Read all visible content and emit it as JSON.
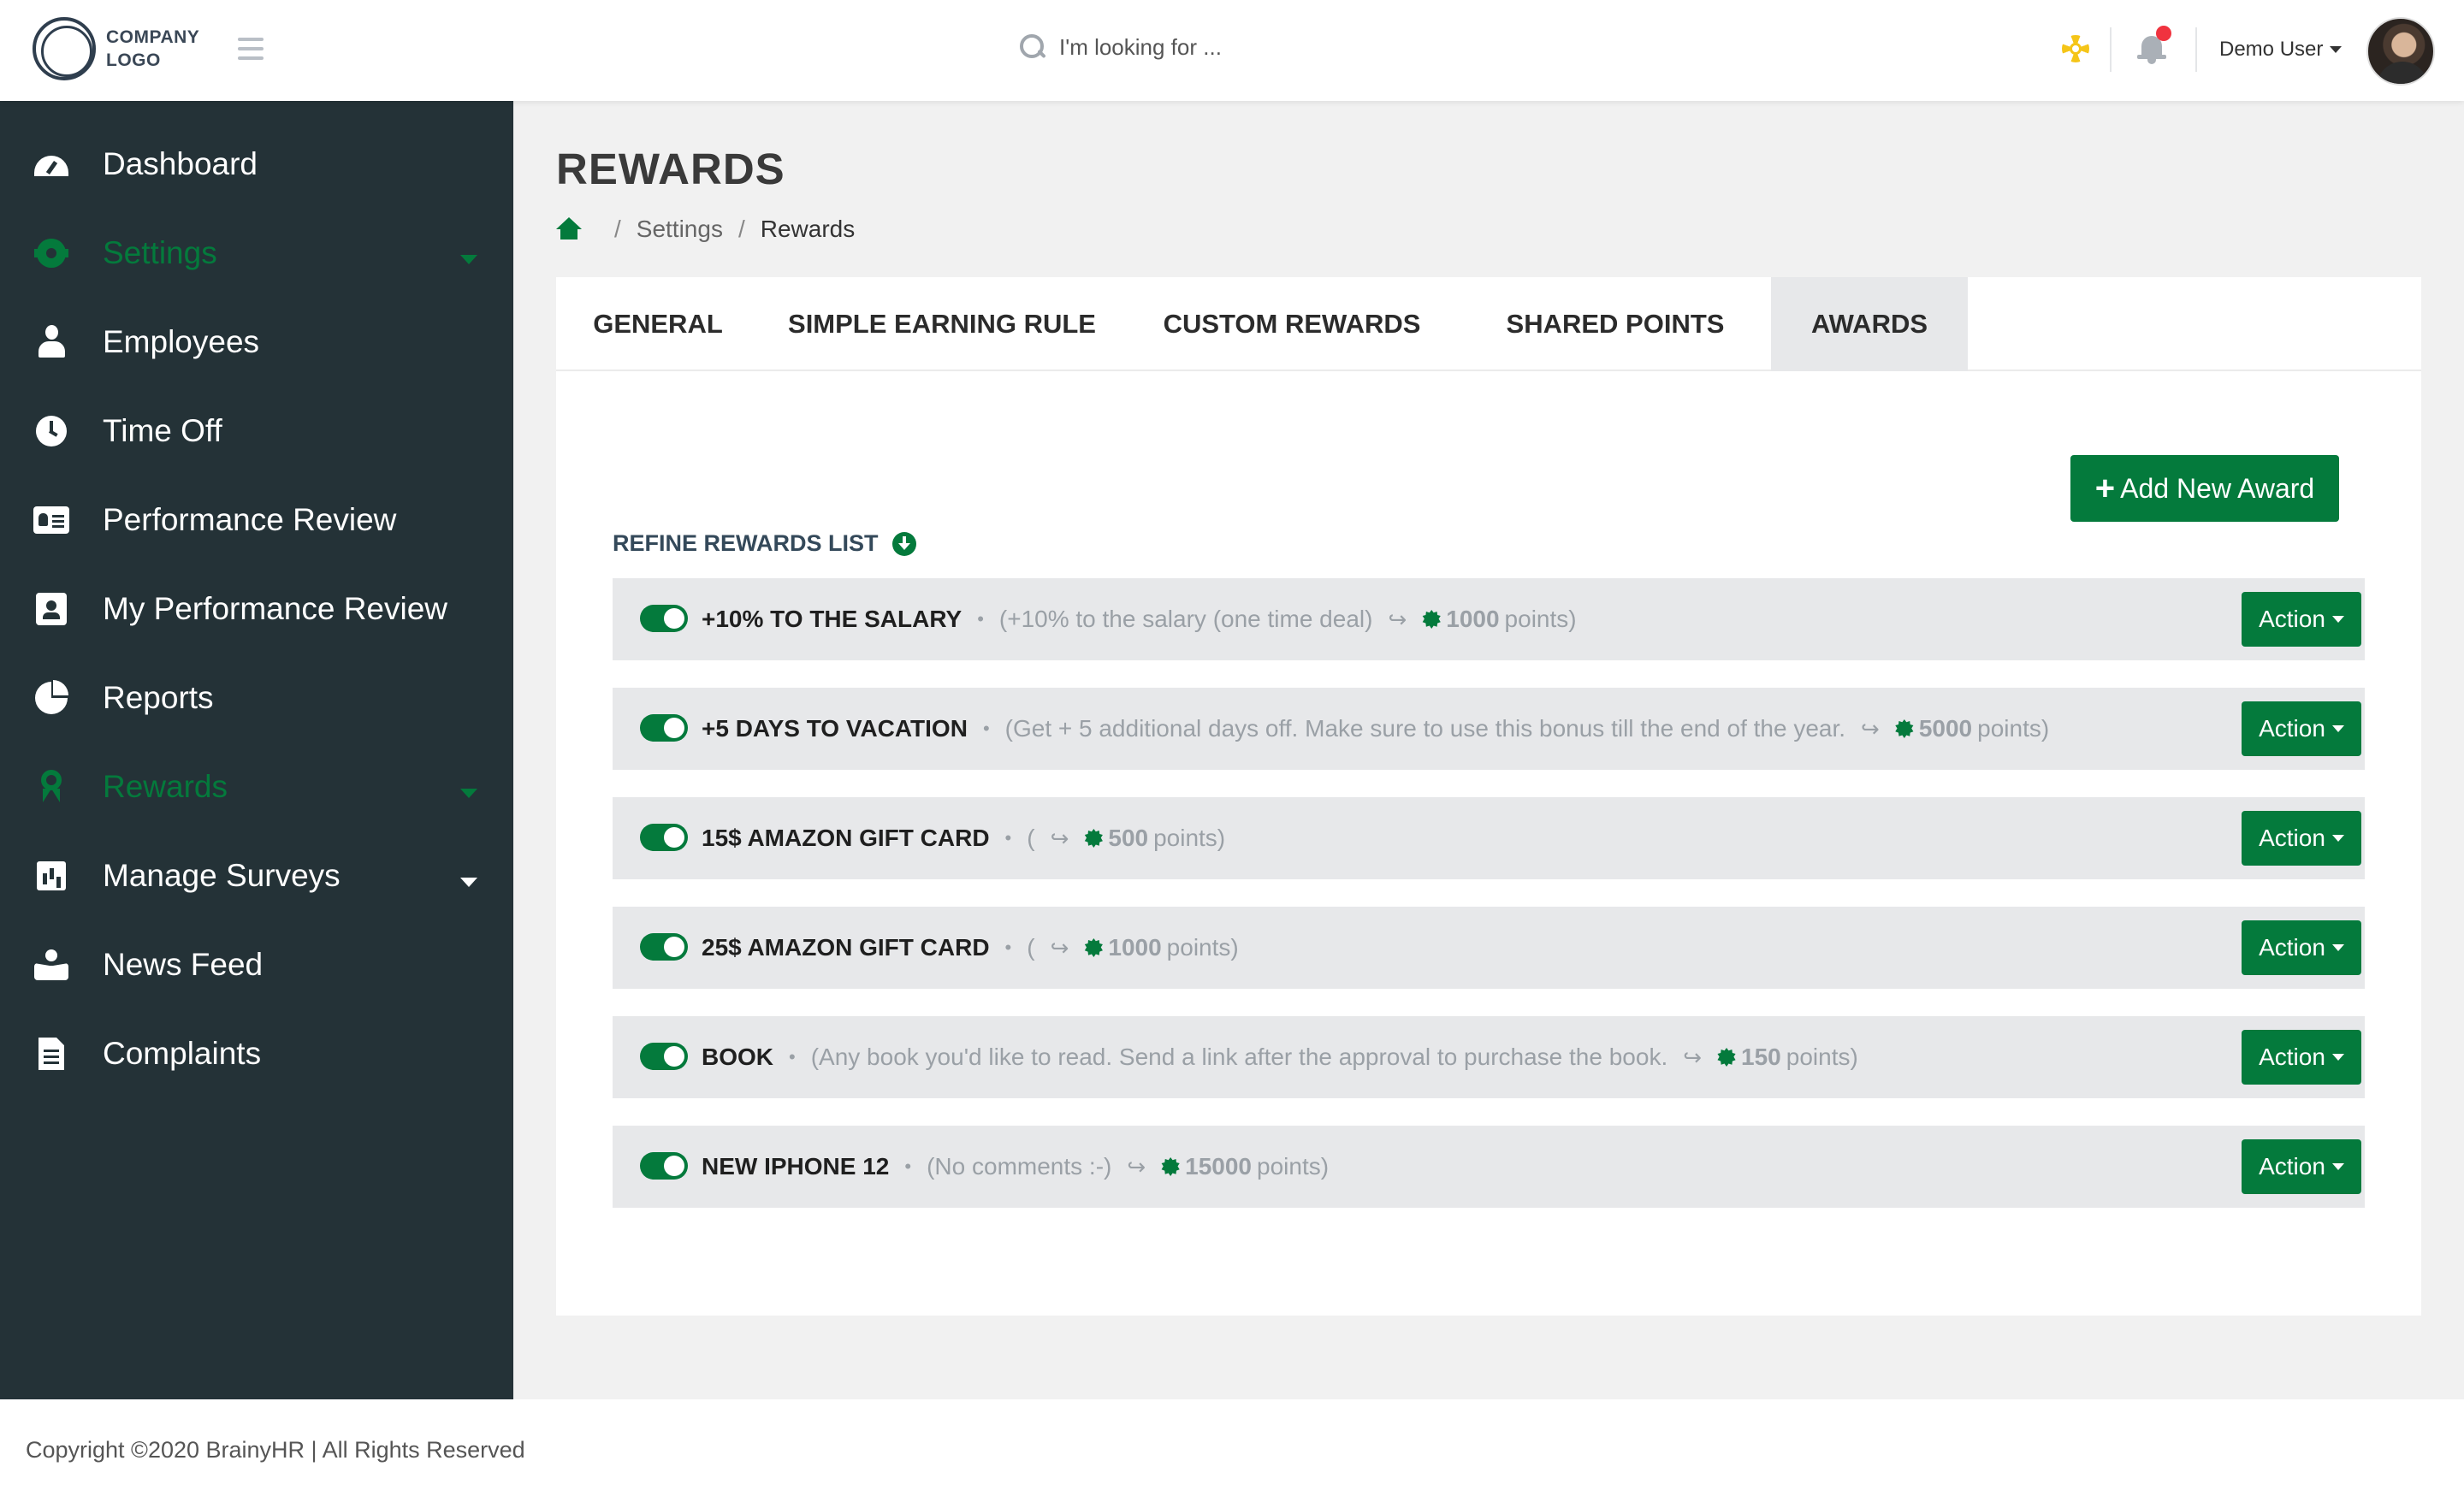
{
  "header": {
    "logo_line1": "COMPANY",
    "logo_line2": "LOGO",
    "search_placeholder": "I'm looking for ...",
    "user_name": "Demo User"
  },
  "sidebar": {
    "items": [
      {
        "label": "Dashboard",
        "icon": "tachometer-icon"
      },
      {
        "label": "Settings",
        "icon": "gear-icon"
      },
      {
        "label": "Employees",
        "icon": "user-tie-icon"
      },
      {
        "label": "Time Off",
        "icon": "clock-icon"
      },
      {
        "label": "Performance Review",
        "icon": "id-card-icon"
      },
      {
        "label": "My Performance Review",
        "icon": "id-badge-icon"
      },
      {
        "label": "Reports",
        "icon": "pie-chart-icon"
      },
      {
        "label": "Rewards",
        "icon": "award-icon"
      },
      {
        "label": "Manage Surveys",
        "icon": "bar-chart-icon"
      },
      {
        "label": "News Feed",
        "icon": "people-icon"
      },
      {
        "label": "Complaints",
        "icon": "file-icon"
      }
    ]
  },
  "page": {
    "title": "REWARDS",
    "breadcrumb": [
      "Settings",
      "Rewards"
    ]
  },
  "tabs": [
    "GENERAL",
    "SIMPLE EARNING RULE",
    "CUSTOM REWARDS",
    "SHARED POINTS",
    "AWARDS"
  ],
  "toolbar": {
    "add_label": "Add New Award",
    "refine_label": "REFINE REWARDS LIST"
  },
  "rewards": [
    {
      "name": "+10% TO THE SALARY",
      "description": "(+10% to the salary (one time deal)",
      "points": "1000",
      "points_label": "points)",
      "action": "Action"
    },
    {
      "name": "+5 DAYS TO VACATION",
      "description": "(Get + 5 additional days off. Make sure to use this bonus till the end of the year.",
      "points": "5000",
      "points_label": "points)",
      "action": "Action"
    },
    {
      "name": "15$ AMAZON GIFT CARD",
      "description": "(",
      "points": "500",
      "points_label": "points)",
      "action": "Action"
    },
    {
      "name": "25$ AMAZON GIFT CARD",
      "description": "(",
      "points": "1000",
      "points_label": "points)",
      "action": "Action"
    },
    {
      "name": "BOOK",
      "description": "(Any book you'd like to read. Send a link after the approval to purchase the book.",
      "points": "150",
      "points_label": "points)",
      "action": "Action"
    },
    {
      "name": "NEW IPHONE 12",
      "description": "(No comments :-)",
      "points": "15000",
      "points_label": "points)",
      "action": "Action"
    }
  ],
  "footer": {
    "copyright": "Copyright ©2020 BrainyHR | All Rights Reserved"
  },
  "colors": {
    "brand_green": "#047a3c",
    "sidebar_bg": "#243237",
    "notification_dot": "#f0333f",
    "support_icon": "#f5c518"
  }
}
